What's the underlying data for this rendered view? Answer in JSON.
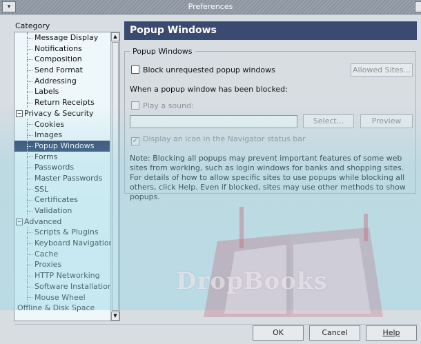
{
  "window": {
    "title": "Preferences"
  },
  "sidebar": {
    "label": "Category",
    "items": [
      {
        "label": "Message Display",
        "type": "child"
      },
      {
        "label": "Notifications",
        "type": "child"
      },
      {
        "label": "Composition",
        "type": "child"
      },
      {
        "label": "Send Format",
        "type": "child"
      },
      {
        "label": "Addressing",
        "type": "child"
      },
      {
        "label": "Labels",
        "type": "child"
      },
      {
        "label": "Return Receipts",
        "type": "child"
      },
      {
        "label": "Privacy & Security",
        "type": "parent"
      },
      {
        "label": "Cookies",
        "type": "child"
      },
      {
        "label": "Images",
        "type": "child"
      },
      {
        "label": "Popup Windows",
        "type": "child",
        "selected": true
      },
      {
        "label": "Forms",
        "type": "child"
      },
      {
        "label": "Passwords",
        "type": "child"
      },
      {
        "label": "Master Passwords",
        "type": "child"
      },
      {
        "label": "SSL",
        "type": "child"
      },
      {
        "label": "Certificates",
        "type": "child"
      },
      {
        "label": "Validation",
        "type": "child"
      },
      {
        "label": "Advanced",
        "type": "parent"
      },
      {
        "label": "Scripts & Plugins",
        "type": "child"
      },
      {
        "label": "Keyboard Navigation",
        "type": "child"
      },
      {
        "label": "Cache",
        "type": "child"
      },
      {
        "label": "Proxies",
        "type": "child"
      },
      {
        "label": "HTTP Networking",
        "type": "child"
      },
      {
        "label": "Software Installation",
        "type": "child"
      },
      {
        "label": "Mouse Wheel",
        "type": "child"
      },
      {
        "label": "Offline & Disk Space",
        "type": "toplevel"
      }
    ]
  },
  "panel": {
    "header": "Popup Windows",
    "group_label": "Popup Windows",
    "block_checkbox_label": "Block unrequested popup windows",
    "allowed_sites_button": "Allowed Sites...",
    "when_blocked_label": "When a popup window has been blocked:",
    "play_sound_label": "Play a sound:",
    "sound_field_value": "",
    "select_button": "Select...",
    "preview_button": "Preview",
    "display_icon_label": "Display an icon in the Navigator status bar",
    "note": "Note: Blocking all popups may prevent important features of some web sites from working, such as login windows for banks and shopping sites. For details of how to allow specific sites to use popups while blocking all others, click Help. Even if blocked, sites may use other methods to show popups."
  },
  "footer": {
    "ok": "OK",
    "cancel": "Cancel",
    "help": "Help"
  },
  "watermark": "DropBooks",
  "colors": {
    "header_bg": "#3a4a70",
    "selection_bg": "#2d3e66",
    "overlay": "#8cd2e1"
  }
}
